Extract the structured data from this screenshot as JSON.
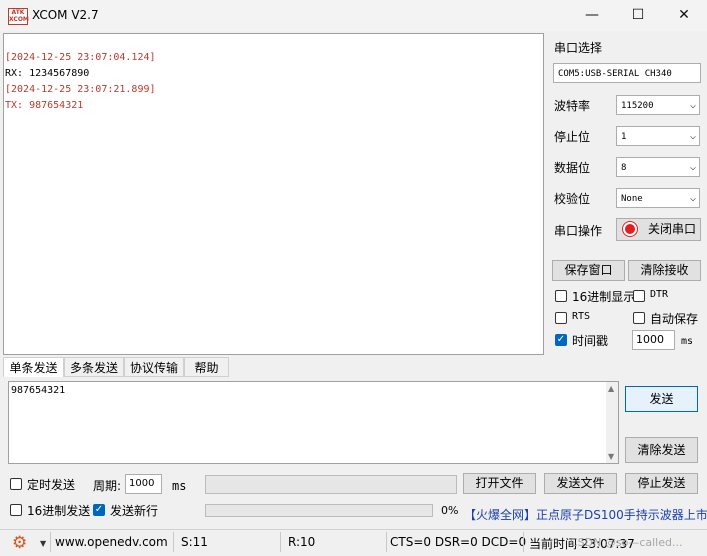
{
  "window": {
    "icon_text": "ATK XCOM",
    "title": "XCOM V2.7",
    "minimize": "—",
    "maximize": "☐",
    "close": "✕"
  },
  "receive": {
    "lines": [
      {
        "text": "[2024-12-25 23:07:04.124]",
        "color": "#c0392b"
      },
      {
        "text": "RX: 1234567890",
        "color": "#000000"
      },
      {
        "text": "[2024-12-25 23:07:21.899]",
        "color": "#c0392b"
      },
      {
        "text": "TX: 987654321",
        "color": "#c0392b"
      }
    ]
  },
  "settings": {
    "port_select_label": "串口选择",
    "port_value": "COM5:USB-SERIAL CH340",
    "baud_label": "波特率",
    "baud_value": "115200",
    "stop_label": "停止位",
    "stop_value": "1",
    "data_label": "数据位",
    "data_value": "8",
    "parity_label": "校验位",
    "parity_value": "None",
    "op_label": "串口操作",
    "op_button": "关闭串口"
  },
  "buttons": {
    "save_window": "保存窗口",
    "clear_receive": "清除接收",
    "send": "发送",
    "clear_send": "清除发送",
    "open_file": "打开文件",
    "send_file": "发送文件",
    "stop_send": "停止发送"
  },
  "options": {
    "hex_display": "16进制显示",
    "dtr": "DTR",
    "rts": "RTS",
    "auto_save": "自动保存",
    "timestamp": "时间戳",
    "timestamp_ms": "1000",
    "ms_unit": "ms"
  },
  "tabs": [
    "单条发送",
    "多条发送",
    "协议传输",
    "帮助"
  ],
  "send": {
    "text": "987654321"
  },
  "bottom": {
    "timed_send": "定时发送",
    "period_label": "周期:",
    "period_value": "1000",
    "period_unit": "ms",
    "hex_send": "16进制发送",
    "send_newline": "发送新行",
    "progress_text": "0%",
    "ad_text": "【火爆全网】正点原子DS100手持示波器上市"
  },
  "status": {
    "url": "www.openedv.com",
    "s": "S:11",
    "r": "R:10",
    "signals": "CTS=0 DSR=0 DCD=0",
    "time": "当前时间 23:07:37",
    "watermark": "CSDN @so—called..."
  },
  "colors": {
    "accent": "#0067c0",
    "record": "#e02020",
    "ad": "#1a3fb0"
  }
}
